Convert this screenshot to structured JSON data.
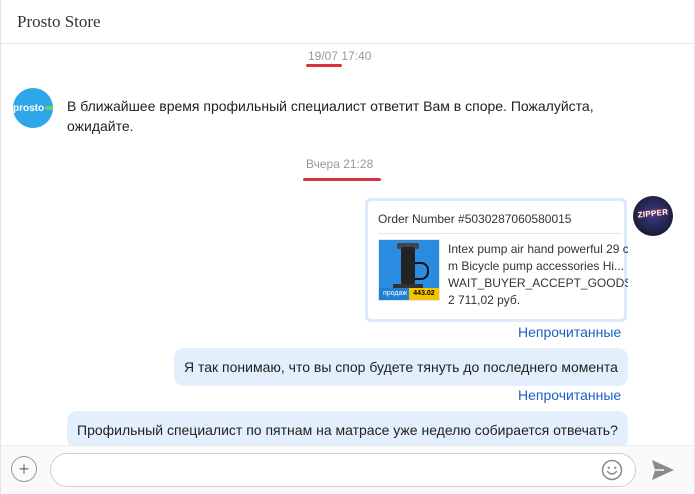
{
  "header": {
    "title": "Prosto Store"
  },
  "chat": {
    "date1": {
      "day": "19/07",
      "time": "17:40"
    },
    "system_avatar": {
      "text": "prosto"
    },
    "system_message": "В ближайшее время профильный специалист ответит Вам в споре. Пожалуйста, ожидайте.",
    "date2": {
      "label": "Вчера 21:28"
    },
    "user_avatar": {
      "text": "ZIPPER"
    },
    "order_card": {
      "order_number": "Order Number #5030287060580015",
      "product_line1": "Intex pump air hand powerful 29 c",
      "product_line2": "m Bicycle pump accessories Hi...",
      "status": "WAIT_BUYER_ACCEPT_GOODS",
      "price": "2 711,02 руб.",
      "thumb_badge_left": "продаж 24%",
      "thumb_badge_right": "443.02"
    },
    "read_status_1": "Непрочитанные",
    "message_1": "Я так понимаю, что вы спор будете тянуть до последнего момента",
    "read_status_2": "Непрочитанные",
    "message_2": "Профильный специалист по пятнам на матрасе уже неделю собирается отвечать?"
  },
  "composer": {
    "placeholder": ""
  },
  "colors": {
    "accent_underline": "#d9343b",
    "bubble": "#e3effc",
    "status_link": "#1a60c4"
  }
}
